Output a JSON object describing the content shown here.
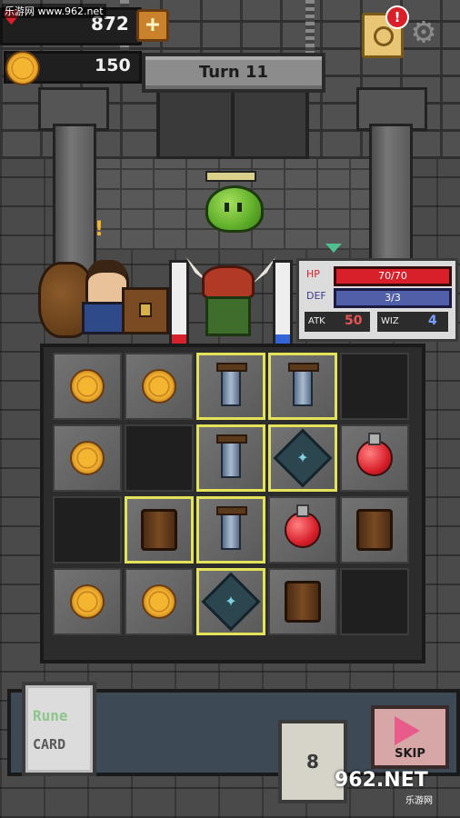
{
  "watermark_top": "乐游网 www.962.net",
  "watermark_bottom": {
    "brand": "962.NET",
    "sub": "乐游网"
  },
  "hud": {
    "hp_icon": "heart-icon",
    "hp_value": "872",
    "plus_label": "+",
    "coins_icon": "coin-icon",
    "coins_value": "150",
    "turn_label": "Turn 11",
    "quest_badge": "!",
    "settings_icon": "gear-icon"
  },
  "npc": {
    "alert": "!"
  },
  "stats": {
    "hp_label": "HP",
    "hp_value": "70/70",
    "def_label": "DEF",
    "def_value": "3/3",
    "atk_label": "ATK",
    "atk_value": "50",
    "wiz_label": "WIZ",
    "wiz_value": "4"
  },
  "board": {
    "tiles": [
      [
        "coin",
        "coin",
        "pillar",
        "pillar",
        "empty"
      ],
      [
        "coin",
        "empty",
        "pillar",
        "rune",
        "potion"
      ],
      [
        "empty",
        "shield",
        "pillar",
        "potion",
        "shield"
      ],
      [
        "coin",
        "coin",
        "rune",
        "shield",
        "empty"
      ]
    ],
    "selected": [
      [
        0,
        2
      ],
      [
        0,
        3
      ],
      [
        1,
        2
      ],
      [
        1,
        3
      ],
      [
        2,
        1
      ],
      [
        2,
        2
      ],
      [
        3,
        2
      ]
    ]
  },
  "bottom": {
    "rune_card_line1": "Rune",
    "rune_card_line2": "CARD",
    "deck_count": "8",
    "skip_label": "SKIP"
  },
  "colors": {
    "selected_border": "#e3e35a",
    "hp": "#d8202b",
    "def": "#5060a8",
    "gold": "#f4b531"
  }
}
